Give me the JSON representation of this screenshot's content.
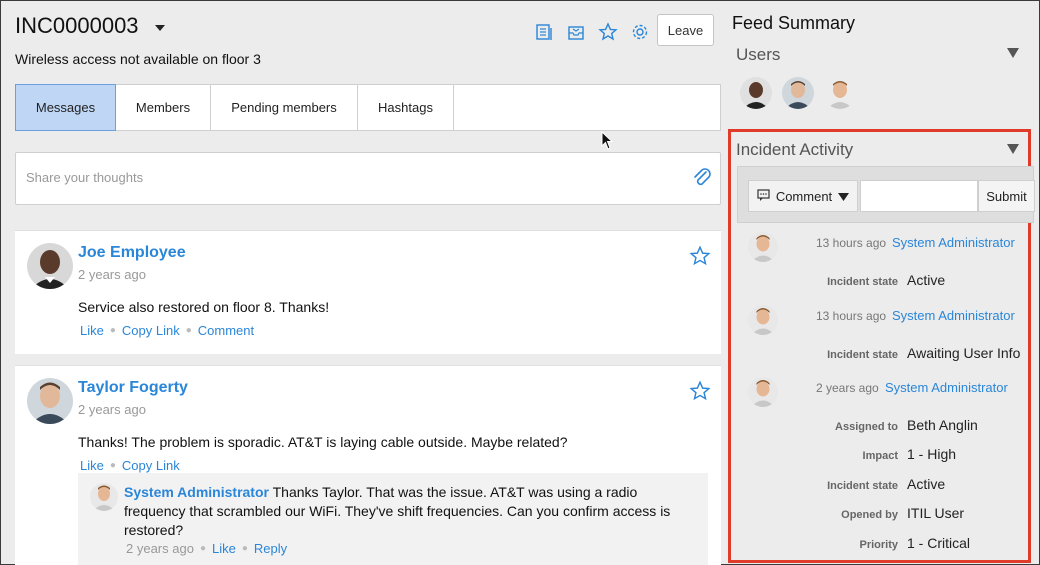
{
  "header": {
    "title": "INC0000003",
    "subtitle": "Wireless access not available on floor 3",
    "leave_label": "Leave",
    "icons": [
      "feed-icon",
      "inbox-icon",
      "star-icon",
      "gear-icon"
    ],
    "accent": "#2a86d8"
  },
  "tabs": [
    {
      "label": "Messages",
      "active": true
    },
    {
      "label": "Members",
      "active": false
    },
    {
      "label": "Pending members",
      "active": false
    },
    {
      "label": "Hashtags",
      "active": false
    }
  ],
  "share": {
    "placeholder": "Share your thoughts"
  },
  "posts": [
    {
      "author": "Joe Employee",
      "ago": "2 years ago",
      "text": "Service also restored on floor 8. Thanks!",
      "actions": [
        "Like",
        "Copy Link",
        "Comment"
      ]
    },
    {
      "author": "Taylor Fogerty",
      "ago": "2 years ago",
      "text": "Thanks! The problem is sporadic. AT&T is laying cable outside. Maybe related?",
      "actions": [
        "Like",
        "Copy Link"
      ],
      "reply": {
        "author": "System Administrator",
        "text": " Thanks Taylor. That was the issue. AT&T was using a radio frequency that scrambled our WiFi. They've shift frequencies. Can you confirm access is restored?",
        "ago": "2 years ago",
        "actions": [
          "Like",
          "Reply"
        ]
      }
    }
  ],
  "sidebar": {
    "feed_summary": "Feed Summary",
    "users_label": "Users",
    "activity_label": "Incident Activity",
    "highlight_color": "#e03a2b",
    "comment_label": "Comment",
    "submit_label": "Submit",
    "activities": [
      {
        "time": "13 hours ago",
        "user": "System Administrator",
        "fields": [
          {
            "label": "Incident state",
            "value": "Active"
          }
        ]
      },
      {
        "time": "13 hours ago",
        "user": "System Administrator",
        "fields": [
          {
            "label": "Incident state",
            "value": "Awaiting User Info"
          }
        ]
      },
      {
        "time": "2 years ago",
        "user": "System Administrator",
        "fields": [
          {
            "label": "Assigned to",
            "value": "Beth Anglin"
          },
          {
            "label": "Impact",
            "value": "1 - High"
          },
          {
            "label": "Incident state",
            "value": "Active"
          },
          {
            "label": "Opened by",
            "value": "ITIL User"
          },
          {
            "label": "Priority",
            "value": "1 - Critical"
          }
        ]
      }
    ]
  }
}
